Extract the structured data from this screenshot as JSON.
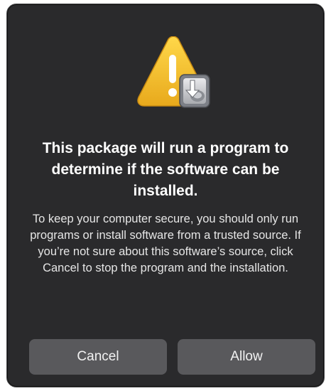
{
  "dialog": {
    "icon": "warning-triangle-with-installer-package-icon",
    "title": "This package will run a program to determine if the software can be installed.",
    "message": "To keep your computer secure, you should only run programs or install software from a trusted source. If you’re not sure about this software’s source, click Cancel to stop the program and the installation.",
    "buttons": {
      "cancel": "Cancel",
      "allow": "Allow"
    }
  },
  "colors": {
    "dialog_background": "#2a2a2c",
    "button_background": "#59595c",
    "warning_yellow": "#f5c12a"
  }
}
